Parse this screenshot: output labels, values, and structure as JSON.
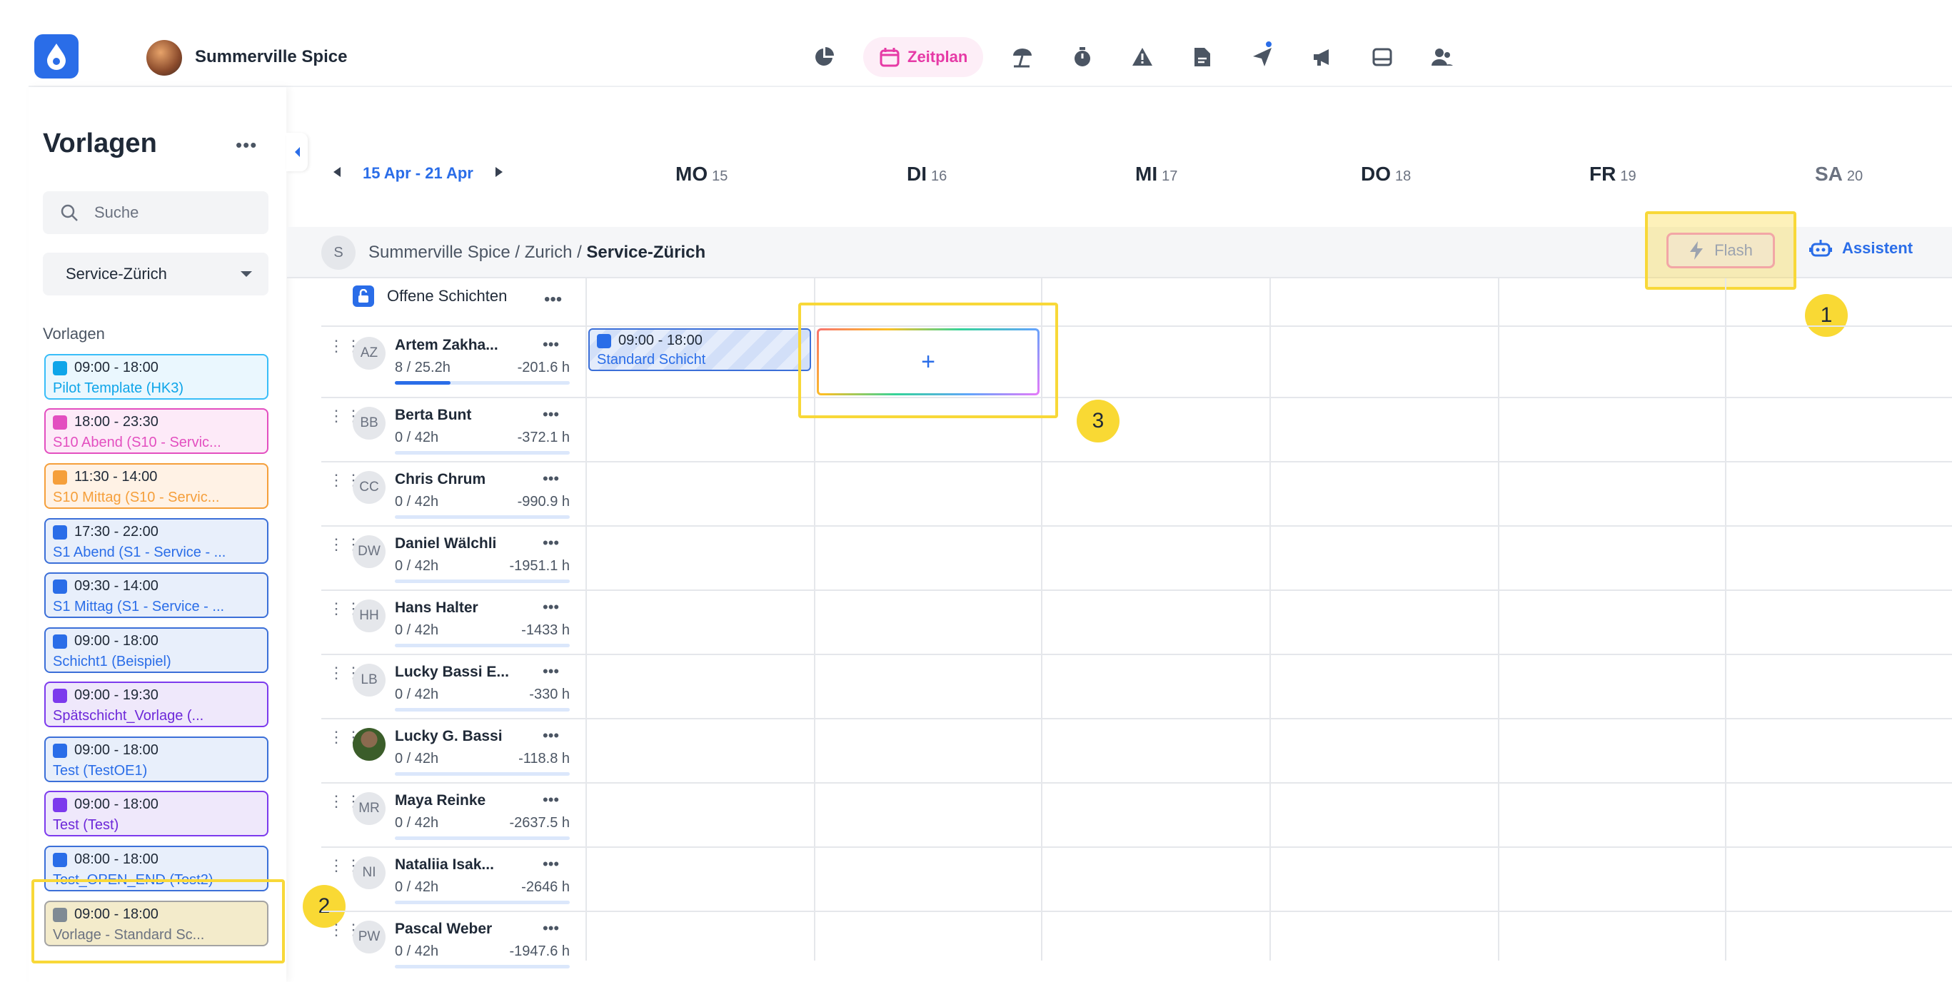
{
  "org": {
    "name": "Summerville Spice"
  },
  "nav": {
    "active_label": "Zeitplan",
    "icons": [
      "pie-chart-icon",
      "calendar-icon",
      "umbrella-icon",
      "stopwatch-icon",
      "warning-icon",
      "document-icon",
      "send-icon",
      "megaphone-icon",
      "inbox-icon",
      "users-icon"
    ]
  },
  "sidebar": {
    "title": "Vorlagen",
    "search_placeholder": "Suche",
    "selected_location": "Service-Zürich",
    "section_label": "Vorlagen",
    "templates": [
      {
        "time": "09:00 - 18:00",
        "name": "Pilot Template (HK3)",
        "color": "cyan"
      },
      {
        "time": "18:00 - 23:30",
        "name": "S10 Abend (S10 - Servic...",
        "color": "pink"
      },
      {
        "time": "11:30 - 14:00",
        "name": "S10 Mittag (S10 - Servic...",
        "color": "orange"
      },
      {
        "time": "17:30 - 22:00",
        "name": "S1 Abend (S1 - Service - ...",
        "color": "blue"
      },
      {
        "time": "09:30 - 14:00",
        "name": "S1 Mittag (S1 - Service - ...",
        "color": "blue"
      },
      {
        "time": "09:00 - 18:00",
        "name": "Schicht1 (Beispiel)",
        "color": "blue"
      },
      {
        "time": "09:00 - 19:30",
        "name": "Spätschicht_Vorlage (...",
        "color": "purple"
      },
      {
        "time": "09:00 - 18:00",
        "name": "Test (TestOE1)",
        "color": "blue"
      },
      {
        "time": "09:00 - 18:00",
        "name": "Test (Test)",
        "color": "purple"
      },
      {
        "time": "08:00 - 18:00",
        "name": "Test_OPEN_END (Test2)",
        "color": "blue"
      },
      {
        "time": "09:00 - 18:00",
        "name": "Vorlage - Standard Sc...",
        "color": "hl"
      }
    ]
  },
  "week": {
    "range": "15 Apr - 21 Apr",
    "days": [
      {
        "abbr": "MO",
        "num": "15"
      },
      {
        "abbr": "DI",
        "num": "16"
      },
      {
        "abbr": "MI",
        "num": "17"
      },
      {
        "abbr": "DO",
        "num": "18"
      },
      {
        "abbr": "FR",
        "num": "19"
      },
      {
        "abbr": "SA",
        "num": "20"
      }
    ]
  },
  "group": {
    "avatar": "S",
    "path": "Summerville Spice / Zurich / ",
    "current": "Service-Zürich"
  },
  "actions": {
    "flash": "Flash",
    "assistant": "Assistent"
  },
  "open_shifts": {
    "label": "Offene Schichten"
  },
  "employees": [
    {
      "initials": "AZ",
      "name": "Artem Zakha...",
      "hours": "8 / 25.2h",
      "balance": "-201.6 h",
      "progress": 0.32
    },
    {
      "initials": "BB",
      "name": "Berta Bunt",
      "hours": "0 / 42h",
      "balance": "-372.1 h",
      "progress": 0
    },
    {
      "initials": "CC",
      "name": "Chris Chrum",
      "hours": "0 / 42h",
      "balance": "-990.9 h",
      "progress": 0
    },
    {
      "initials": "DW",
      "name": "Daniel Wälchli",
      "hours": "0 / 42h",
      "balance": "-1951.1 h",
      "progress": 0
    },
    {
      "initials": "HH",
      "name": "Hans Halter",
      "hours": "0 / 42h",
      "balance": "-1433 h",
      "progress": 0
    },
    {
      "initials": "LB",
      "name": "Lucky Bassi E...",
      "hours": "0 / 42h",
      "balance": "-330 h",
      "progress": 0
    },
    {
      "initials": "",
      "name": "Lucky G. Bassi",
      "hours": "0 / 42h",
      "balance": "-118.8 h",
      "progress": 0,
      "photo": true
    },
    {
      "initials": "MR",
      "name": "Maya Reinke",
      "hours": "0 / 42h",
      "balance": "-2637.5 h",
      "progress": 0
    },
    {
      "initials": "NI",
      "name": "Nataliia Isak...",
      "hours": "0 / 42h",
      "balance": "-2646 h",
      "progress": 0
    },
    {
      "initials": "PW",
      "name": "Pascal Weber",
      "hours": "0 / 42h",
      "balance": "-1947.6 h",
      "progress": 0
    }
  ],
  "shift": {
    "time": "09:00 - 18:00",
    "name": "Standard Schicht"
  },
  "add_symbol": "+",
  "callouts": [
    "1",
    "2",
    "3"
  ],
  "more_symbol": "•••"
}
